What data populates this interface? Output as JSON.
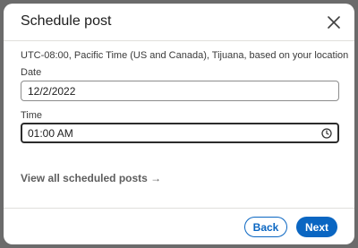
{
  "modal": {
    "title": "Schedule post",
    "timezone_text": "UTC-08:00, Pacific Time (US and Canada), Tijuana, based on your location",
    "date_label": "Date",
    "date_value": "12/2/2022",
    "time_label": "Time",
    "time_value": "01:00 AM",
    "view_all_link": "View all scheduled posts →",
    "back_button": "Back",
    "next_button": "Next"
  },
  "icons": {
    "close": "close-icon",
    "clock": "clock-icon"
  },
  "colors": {
    "accent": "#0a66c2",
    "overlay": "#6b6b6b"
  }
}
